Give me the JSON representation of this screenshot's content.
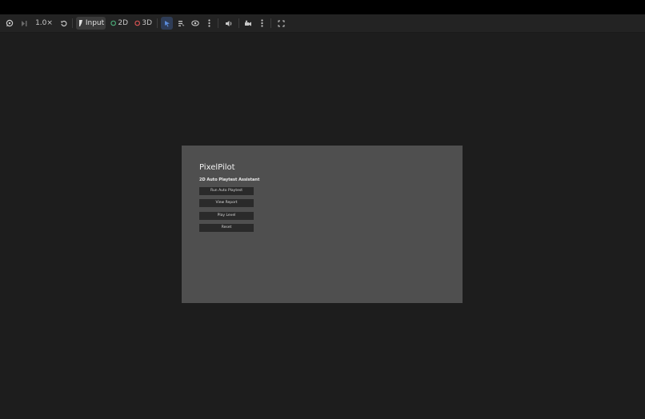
{
  "toolbar": {
    "speed_label": "1.0×",
    "input_label": "Input",
    "mode_2d_label": "2D",
    "mode_3d_label": "3D",
    "mode_2d_color": "#4caf7a",
    "mode_3d_color": "#e05555",
    "select_active_color": "#5b8bd9"
  },
  "game": {
    "title": "PixelPilot",
    "subtitle": "2D Auto Playtest Assistant",
    "buttons": [
      {
        "label": "Run Auto Playtest"
      },
      {
        "label": "View Report"
      },
      {
        "label": "Play Level"
      },
      {
        "label": "Reset"
      }
    ]
  }
}
